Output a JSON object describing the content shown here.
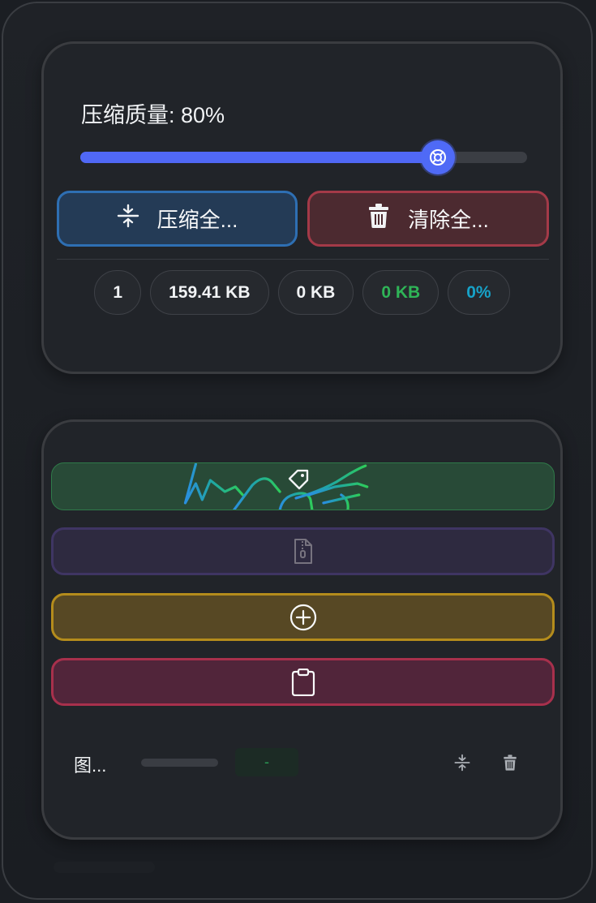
{
  "settings": {
    "quality_label": "压缩质量: 80%",
    "quality_value": 80
  },
  "actions": {
    "compress_all": "压缩全...",
    "clear_all": "清除全..."
  },
  "stats": {
    "count": "1",
    "original_size": "159.41 KB",
    "compressed_size": "0 KB",
    "saved_size": "0 KB",
    "saved_percent": "0%"
  },
  "file": {
    "name": "图...",
    "progress": 0,
    "status": "-"
  },
  "colors": {
    "accent": "#5068f5",
    "saved_green": "#2fb457",
    "percent_cyan": "#17a2c8",
    "compress_border": "#2e6fb3",
    "clear_border": "#a43a48"
  }
}
